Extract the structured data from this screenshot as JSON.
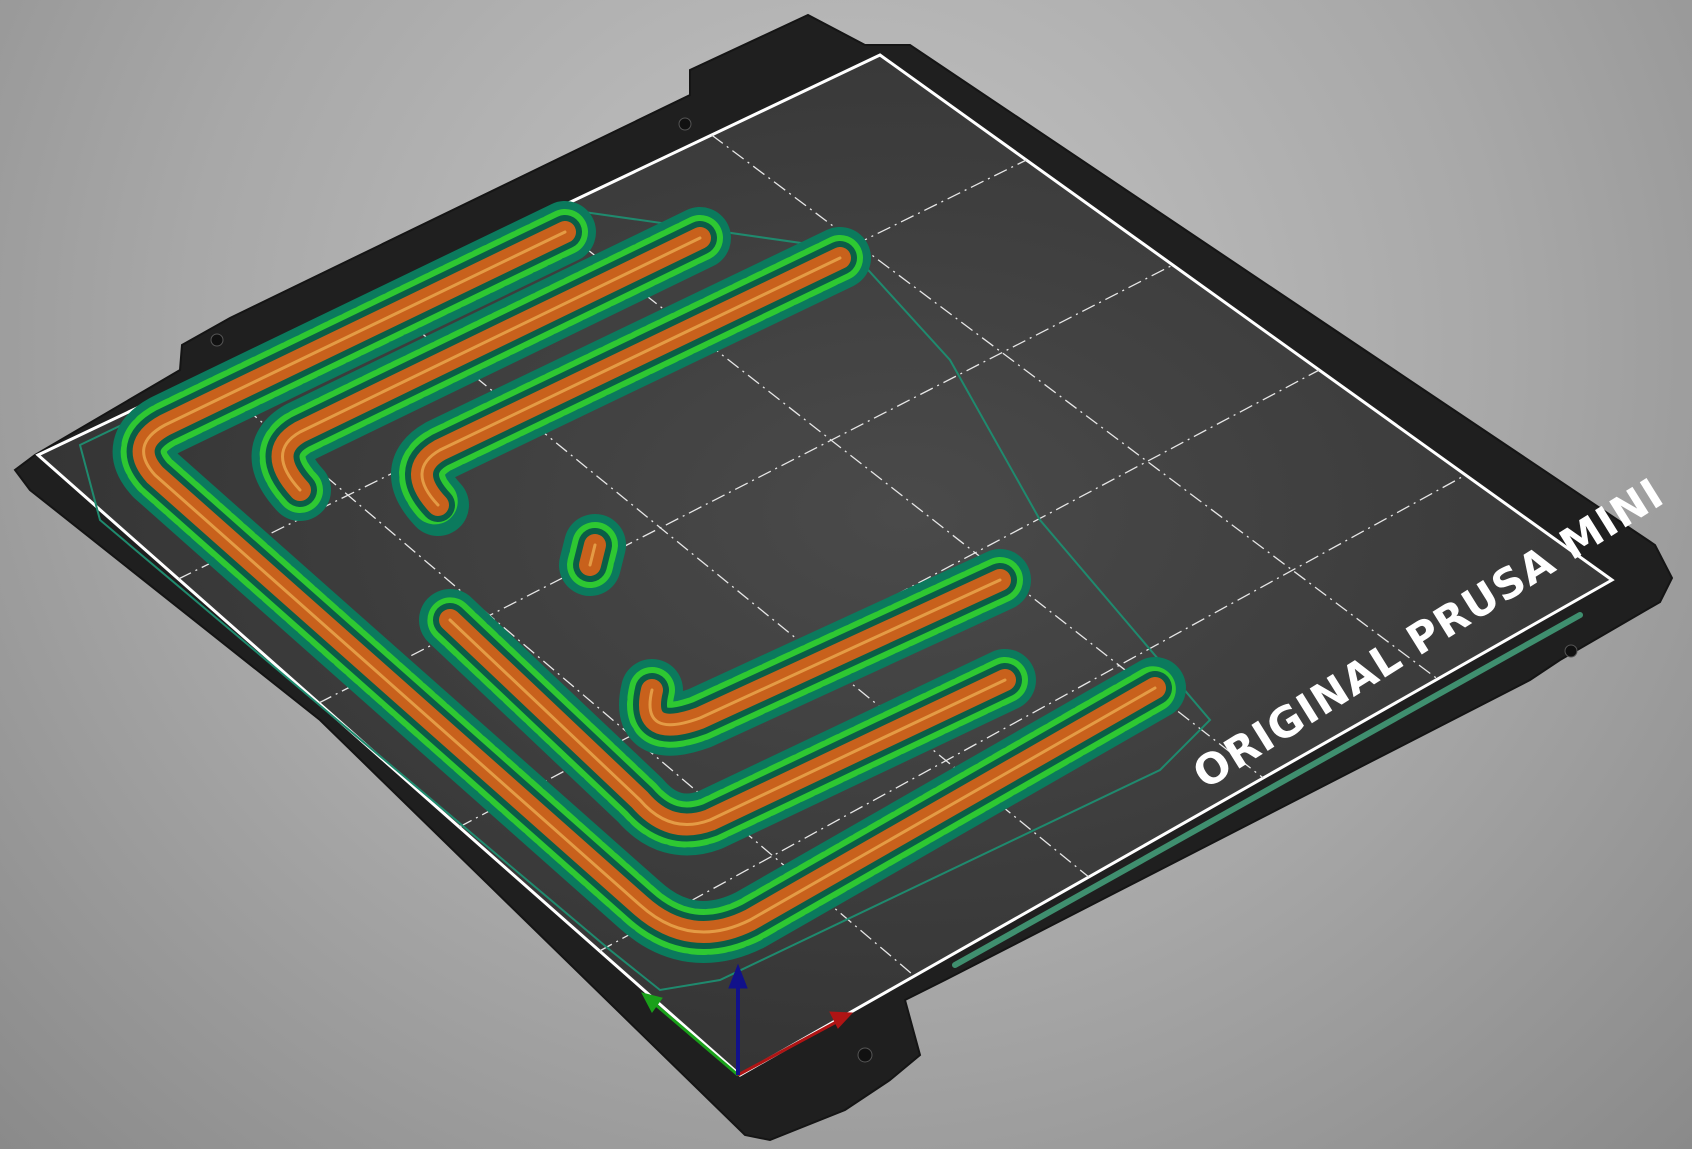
{
  "view": {
    "background": "#a8a8a8"
  },
  "bed": {
    "label": "ORIGINAL PRUSA MINI",
    "sheet_color": "#1f1f1f",
    "surface_color": "#3a3a3a",
    "border_color": "#ffffff",
    "grid_color": "#e6e6e6"
  },
  "toolpaths": {
    "perimeter_color": "#c8611c",
    "perimeter_highlight": "#e7a24a",
    "skirt_color": "#0b7a5d",
    "support_color": "#35d62a",
    "travel_color": "#1f8a6e"
  },
  "axes": {
    "x_color": "#b01414",
    "y_color": "#1aa01a",
    "z_color": "#11118a"
  }
}
